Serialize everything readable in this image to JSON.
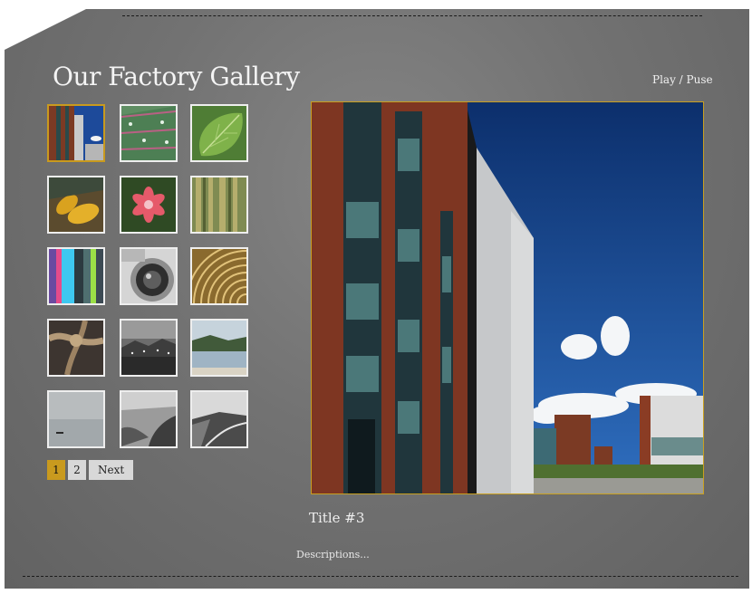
{
  "gallery": {
    "title": "Our Factory Gallery",
    "play_pause_label": "Play / Puse"
  },
  "thumbnails": [
    {
      "subject": "building"
    },
    {
      "subject": "leaf-with-droplets"
    },
    {
      "subject": "green-leaf"
    },
    {
      "subject": "corn"
    },
    {
      "subject": "pink-flower"
    },
    {
      "subject": "bamboo"
    },
    {
      "subject": "color-stripes"
    },
    {
      "subject": "camera-lens"
    },
    {
      "subject": "coiled-wire"
    },
    {
      "subject": "rope-knot"
    },
    {
      "subject": "harbor-night"
    },
    {
      "subject": "lake-landscape"
    },
    {
      "subject": "foggy-sea"
    },
    {
      "subject": "rocky-coast"
    },
    {
      "subject": "coastal-road"
    }
  ],
  "active_thumbnail_index": 0,
  "pager": {
    "pages": [
      "1",
      "2"
    ],
    "active_page": "1",
    "next_label": "Next"
  },
  "main_image": {
    "subject": "factory building"
  },
  "caption": {
    "title": "Title  #3",
    "description": "Descriptions..."
  },
  "colors": {
    "accent": "#c99a1e",
    "panel": "#6f6f6f"
  }
}
